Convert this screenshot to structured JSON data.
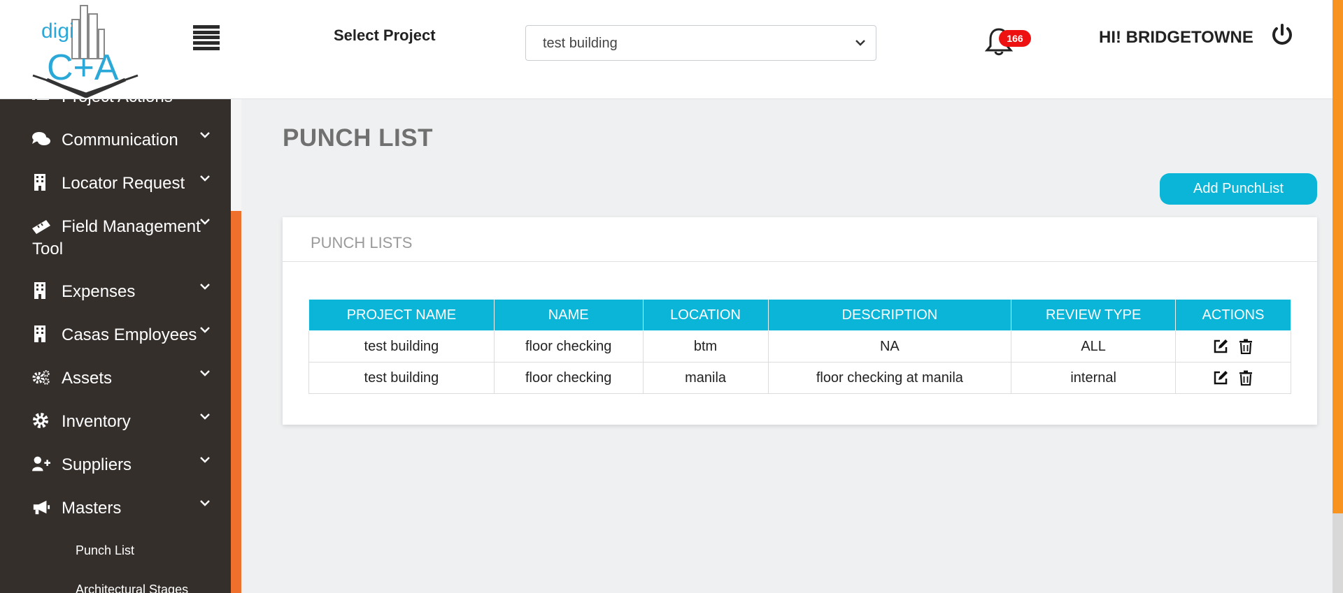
{
  "logo": {
    "text_top": "digi",
    "text_bottom": "C+A"
  },
  "header": {
    "select_label": "Select Project",
    "project_select": {
      "value": "test building"
    },
    "notification_count": "166",
    "greeting": "HI! BRIDGETOWNE"
  },
  "sidebar": {
    "partial_item": "Project Actions",
    "items": [
      {
        "label": "Communication",
        "icon": "comments-icon"
      },
      {
        "label": "Locator Request",
        "icon": "building-icon"
      },
      {
        "label": "Field Management",
        "label2": "Tool",
        "icon": "ruler-icon"
      },
      {
        "label": "Expenses",
        "icon": "building-icon"
      },
      {
        "label": "Casas Employees",
        "icon": "building-icon"
      },
      {
        "label": "Assets",
        "icon": "gears-icon"
      },
      {
        "label": "Inventory",
        "icon": "gear-icon"
      },
      {
        "label": "Suppliers",
        "icon": "user-plus-icon"
      },
      {
        "label": "Masters",
        "icon": "megaphone-icon"
      }
    ],
    "subitems": [
      {
        "label": "Punch List"
      },
      {
        "label": "Architectural Stages"
      }
    ]
  },
  "main": {
    "page_title": "PUNCH LIST",
    "add_button": "Add PunchList",
    "card_title": "PUNCH LISTS",
    "table": {
      "headers": [
        "PROJECT NAME",
        "NAME",
        "LOCATION",
        "DESCRIPTION",
        "REVIEW TYPE",
        "ACTIONS"
      ],
      "rows": [
        [
          "test building",
          "floor checking",
          "btm",
          "NA",
          "ALL"
        ],
        [
          "test building",
          "floor checking",
          "manila",
          "floor checking at manila",
          "internal"
        ]
      ]
    }
  },
  "colors": {
    "accent": "#0ab5d8",
    "sidebar_bg": "#352f2c",
    "orange": "#f7931e",
    "badge": "#ee1111"
  }
}
